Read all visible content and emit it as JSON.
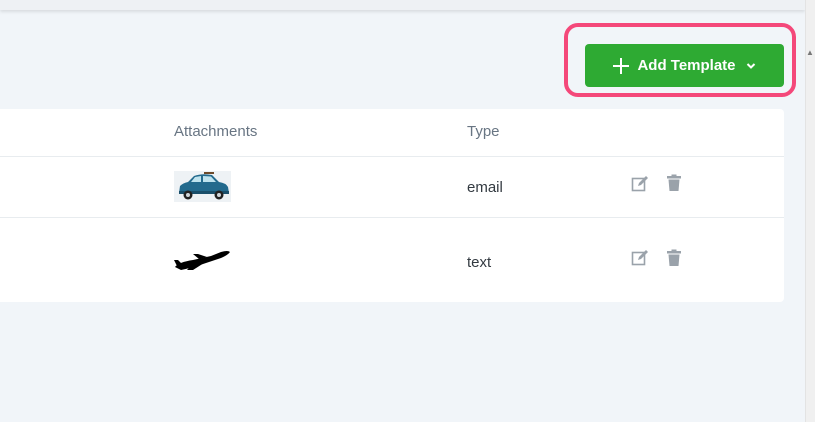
{
  "toolbar": {
    "add_template_label": "Add Template",
    "button_color": "#2eaa33",
    "highlight_color": "#f4487a"
  },
  "table": {
    "columns": [
      "Attachments",
      "Type"
    ],
    "rows": [
      {
        "attachment": "car-thumbnail",
        "type": "email",
        "actions": [
          "edit-icon",
          "trash-icon"
        ]
      },
      {
        "attachment": "airplane-thumbnail",
        "type": "text",
        "actions": [
          "edit-icon",
          "trash-icon"
        ]
      }
    ]
  },
  "icons": {
    "add": "plus-icon",
    "dropdown": "chevron-down-icon",
    "scroll": "scroll-up-arrow-icon"
  }
}
